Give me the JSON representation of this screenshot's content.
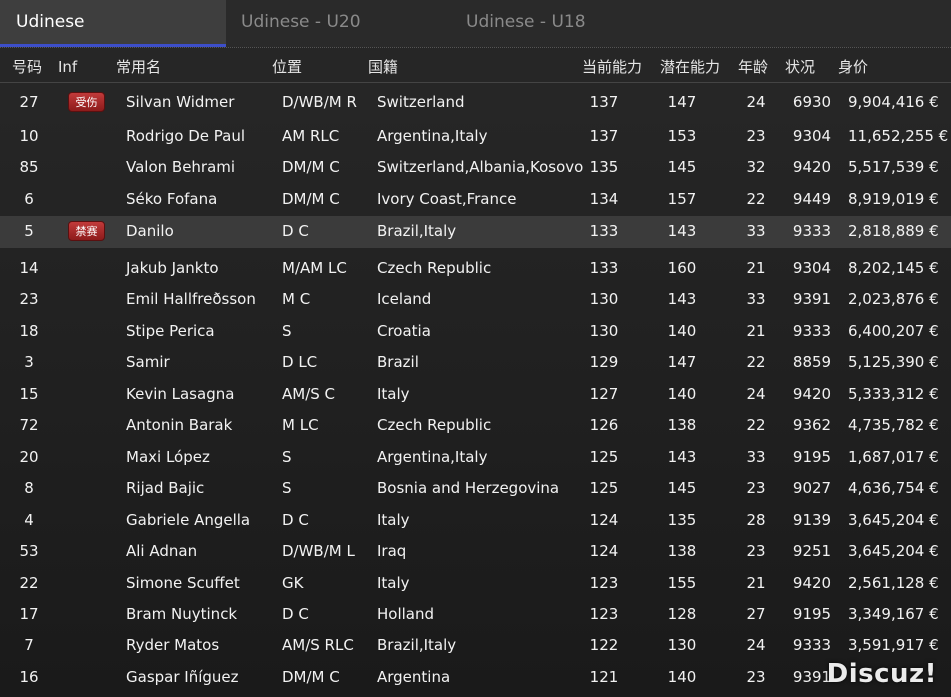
{
  "tabs": [
    "Udinese",
    "Udinese - U20",
    "Udinese - U18"
  ],
  "headers": {
    "num": "号码",
    "inf": "Inf",
    "name": "常用名",
    "pos": "位置",
    "nat": "国籍",
    "ca": "当前能力",
    "pa": "潜在能力",
    "age": "年龄",
    "cond": "状况",
    "val": "身价"
  },
  "players": [
    {
      "num": "27",
      "inf": "受伤",
      "name": "Silvan Widmer",
      "pos": "D/WB/M R",
      "nat": "Switzerland",
      "ca": "137",
      "pa": "147",
      "age": "24",
      "cond": "6930",
      "val": "9,904,416 €"
    },
    {
      "num": "10",
      "inf": "",
      "name": "Rodrigo De Paul",
      "pos": "AM RLC",
      "nat": "Argentina,Italy",
      "ca": "137",
      "pa": "153",
      "age": "23",
      "cond": "9304",
      "val": "11,652,255 €"
    },
    {
      "num": "85",
      "inf": "",
      "name": "Valon Behrami",
      "pos": "DM/M C",
      "nat": "Switzerland,Albania,Kosovo",
      "ca": "135",
      "pa": "145",
      "age": "32",
      "cond": "9420",
      "val": "5,517,539 €"
    },
    {
      "num": "6",
      "inf": "",
      "name": "Séko Fofana",
      "pos": "DM/M C",
      "nat": "Ivory Coast,France",
      "ca": "134",
      "pa": "157",
      "age": "22",
      "cond": "9449",
      "val": "8,919,019 €"
    },
    {
      "num": "5",
      "inf": "禁赛",
      "name": "Danilo",
      "pos": "D C",
      "nat": "Brazil,Italy",
      "ca": "133",
      "pa": "143",
      "age": "33",
      "cond": "9333",
      "val": "2,818,889 €"
    },
    {
      "num": "14",
      "inf": "",
      "name": "Jakub Jankto",
      "pos": "M/AM LC",
      "nat": "Czech Republic",
      "ca": "133",
      "pa": "160",
      "age": "21",
      "cond": "9304",
      "val": "8,202,145 €"
    },
    {
      "num": "23",
      "inf": "",
      "name": "Emil Hallfreðsson",
      "pos": "M C",
      "nat": "Iceland",
      "ca": "130",
      "pa": "143",
      "age": "33",
      "cond": "9391",
      "val": "2,023,876 €"
    },
    {
      "num": "18",
      "inf": "",
      "name": "Stipe Perica",
      "pos": "S",
      "nat": "Croatia",
      "ca": "130",
      "pa": "140",
      "age": "21",
      "cond": "9333",
      "val": "6,400,207 €"
    },
    {
      "num": "3",
      "inf": "",
      "name": "Samir",
      "pos": "D LC",
      "nat": "Brazil",
      "ca": "129",
      "pa": "147",
      "age": "22",
      "cond": "8859",
      "val": "5,125,390 €"
    },
    {
      "num": "15",
      "inf": "",
      "name": "Kevin Lasagna",
      "pos": "AM/S C",
      "nat": "Italy",
      "ca": "127",
      "pa": "140",
      "age": "24",
      "cond": "9420",
      "val": "5,333,312 €"
    },
    {
      "num": "72",
      "inf": "",
      "name": "Antonin Barak",
      "pos": "M LC",
      "nat": "Czech Republic",
      "ca": "126",
      "pa": "138",
      "age": "22",
      "cond": "9362",
      "val": "4,735,782 €"
    },
    {
      "num": "20",
      "inf": "",
      "name": "Maxi López",
      "pos": "S",
      "nat": "Argentina,Italy",
      "ca": "125",
      "pa": "143",
      "age": "33",
      "cond": "9195",
      "val": "1,687,017 €"
    },
    {
      "num": "8",
      "inf": "",
      "name": "Rijad Bajic",
      "pos": "S",
      "nat": "Bosnia and Herzegovina",
      "ca": "125",
      "pa": "145",
      "age": "23",
      "cond": "9027",
      "val": "4,636,754 €"
    },
    {
      "num": "4",
      "inf": "",
      "name": "Gabriele Angella",
      "pos": "D C",
      "nat": "Italy",
      "ca": "124",
      "pa": "135",
      "age": "28",
      "cond": "9139",
      "val": "3,645,204 €"
    },
    {
      "num": "53",
      "inf": "",
      "name": "Ali Adnan",
      "pos": "D/WB/M L",
      "nat": "Iraq",
      "ca": "124",
      "pa": "138",
      "age": "23",
      "cond": "9251",
      "val": "3,645,204 €"
    },
    {
      "num": "22",
      "inf": "",
      "name": "Simone Scuffet",
      "pos": "GK",
      "nat": "Italy",
      "ca": "123",
      "pa": "155",
      "age": "21",
      "cond": "9420",
      "val": "2,561,128 €"
    },
    {
      "num": "17",
      "inf": "",
      "name": "Bram Nuytinck",
      "pos": "D C",
      "nat": "Holland",
      "ca": "123",
      "pa": "128",
      "age": "27",
      "cond": "9195",
      "val": "3,349,167 €"
    },
    {
      "num": "7",
      "inf": "",
      "name": "Ryder Matos",
      "pos": "AM/S RLC",
      "nat": "Brazil,Italy",
      "ca": "122",
      "pa": "130",
      "age": "24",
      "cond": "9333",
      "val": "3,591,917 €"
    },
    {
      "num": "16",
      "inf": "",
      "name": "Gaspar Iñíguez",
      "pos": "DM/M C",
      "nat": "Argentina",
      "ca": "121",
      "pa": "140",
      "age": "23",
      "cond": "9391",
      "val": ""
    }
  ],
  "selected_row": 4,
  "watermark": "Discuz!"
}
